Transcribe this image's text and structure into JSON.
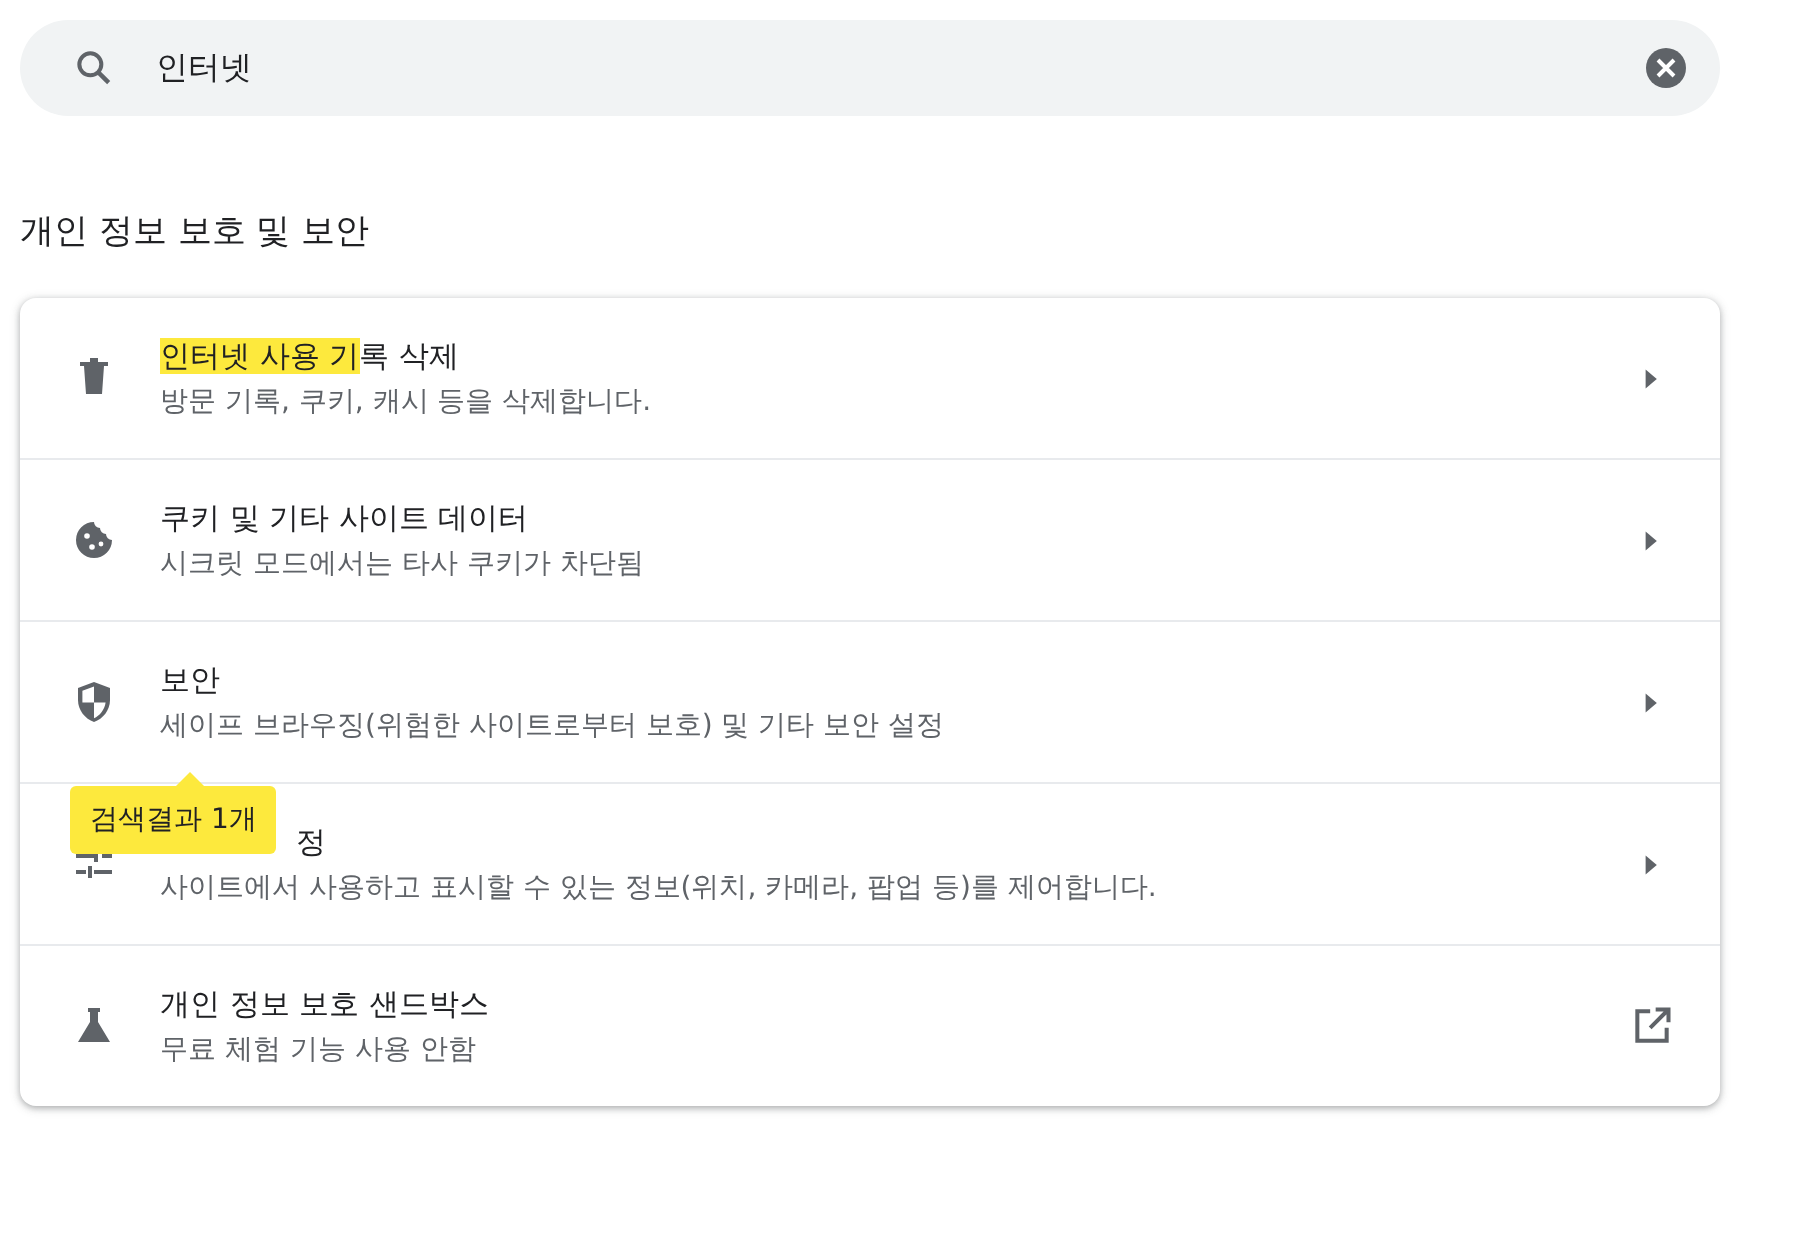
{
  "search": {
    "value": "인터넷"
  },
  "section_title": "개인 정보 보호 및 보안",
  "items": [
    {
      "kind": "link",
      "title_parts": [
        {
          "text": "인터넷 사용 기",
          "highlighted": true
        },
        {
          "text": "록 삭제",
          "highlighted": false
        }
      ],
      "subtitle": "방문 기록, 쿠키, 캐시 등을 삭제합니다."
    },
    {
      "kind": "link",
      "title_parts": [
        {
          "text": "쿠키 및 기타 사이트 데이터",
          "highlighted": false
        }
      ],
      "subtitle": "시크릿 모드에서는 타사 쿠키가 차단됨"
    },
    {
      "kind": "link",
      "title_parts": [
        {
          "text": "보안",
          "highlighted": false
        }
      ],
      "subtitle": "세이프 브라우징(위험한 사이트로부터 보호) 및 기타 보안 설정"
    },
    {
      "kind": "link",
      "tooltip": "검색결과 1개",
      "title_parts": [
        {
          "text": "정",
          "highlighted": false
        }
      ],
      "subtitle": "사이트에서 사용하고 표시할 수 있는 정보(위치, 카메라, 팝업 등)를 제어합니다."
    },
    {
      "kind": "external",
      "title_parts": [
        {
          "text": "개인 정보 보호 샌드박스",
          "highlighted": false
        }
      ],
      "subtitle": "무료 체험 기능 사용 안함"
    }
  ]
}
